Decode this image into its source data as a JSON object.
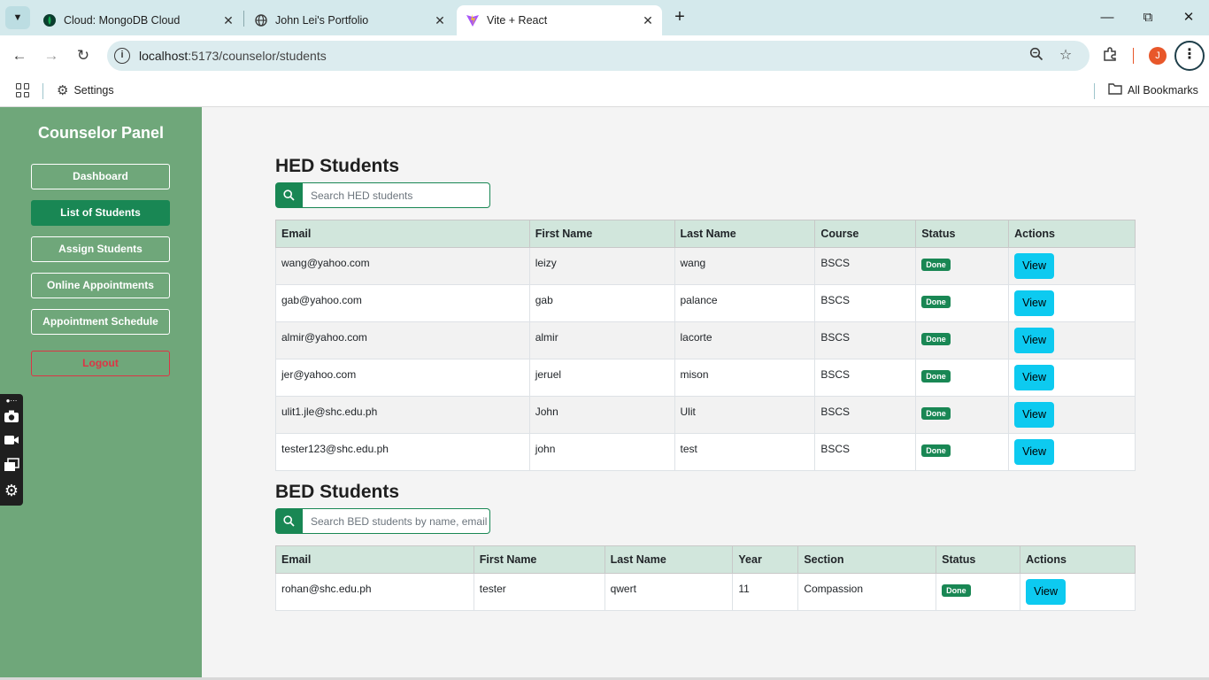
{
  "browser": {
    "tabs": [
      {
        "title": "Cloud: MongoDB Cloud",
        "icon": "mongodb-leaf-icon"
      },
      {
        "title": "John Lei's Portfolio",
        "icon": "globe-icon"
      },
      {
        "title": "Vite + React",
        "icon": "vite-icon"
      }
    ],
    "url_host": "localhost",
    "url_path": ":5173/counselor/students",
    "profile_initial": "J",
    "bookmarks": {
      "settings_label": "Settings",
      "all_bookmarks_label": "All Bookmarks"
    }
  },
  "sidebar": {
    "title": "Counselor Panel",
    "items": [
      {
        "label": "Dashboard"
      },
      {
        "label": "List of Students"
      },
      {
        "label": "Assign Students"
      },
      {
        "label": "Online Appointments"
      },
      {
        "label": "Appointment Schedule"
      }
    ],
    "logout_label": "Logout",
    "active_index": 1
  },
  "hed": {
    "title": "HED Students",
    "search_placeholder": "Search HED students",
    "columns": [
      "Email",
      "First Name",
      "Last Name",
      "Course",
      "Status",
      "Actions"
    ],
    "rows": [
      {
        "email": "wang@yahoo.com",
        "first": "leizy",
        "last": "wang",
        "course": "BSCS",
        "status": "Done",
        "action": "View"
      },
      {
        "email": "gab@yahoo.com",
        "first": "gab",
        "last": "palance",
        "course": "BSCS",
        "status": "Done",
        "action": "View"
      },
      {
        "email": "almir@yahoo.com",
        "first": "almir",
        "last": "lacorte",
        "course": "BSCS",
        "status": "Done",
        "action": "View"
      },
      {
        "email": "jer@yahoo.com",
        "first": "jeruel",
        "last": "mison",
        "course": "BSCS",
        "status": "Done",
        "action": "View"
      },
      {
        "email": "ulit1.jle@shc.edu.ph",
        "first": "John",
        "last": "Ulit",
        "course": "BSCS",
        "status": "Done",
        "action": "View"
      },
      {
        "email": "tester123@shc.edu.ph",
        "first": "john",
        "last": "test",
        "course": "BSCS",
        "status": "Done",
        "action": "View"
      }
    ]
  },
  "bed": {
    "title": "BED Students",
    "search_placeholder": "Search BED students by name, email",
    "columns": [
      "Email",
      "First Name",
      "Last Name",
      "Year",
      "Section",
      "Status",
      "Actions"
    ],
    "rows": [
      {
        "email": "rohan@shc.edu.ph",
        "first": "tester",
        "last": "qwert",
        "year": "11",
        "section": "Compassion",
        "status": "Done",
        "action": "View"
      }
    ]
  },
  "colors": {
    "sidebar_bg": "#6fa77a",
    "primary_green": "#198754",
    "view_button": "#0dcaf0",
    "logout_red": "#dc3545",
    "table_header_bg": "#d1e6dc"
  }
}
